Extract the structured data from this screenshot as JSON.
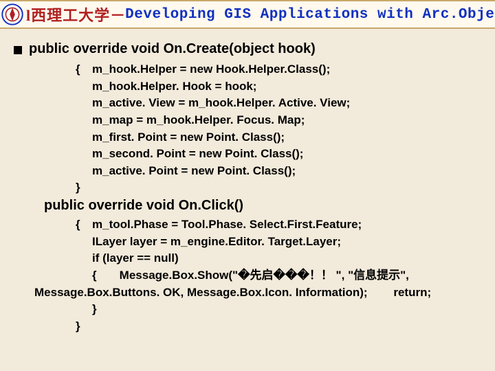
{
  "title": {
    "university": "l西理工大学",
    "separator": "－",
    "course": "Developing GIS Applications with Arc.Objects using C#. NE"
  },
  "section1": {
    "signature": "public override void On.Create(object hook)",
    "lines": [
      "m_hook.Helper = new Hook.Helper.Class();",
      "m_hook.Helper. Hook = hook;",
      "m_active. View = m_hook.Helper. Active. View;",
      "m_map = m_hook.Helper. Focus. Map;",
      "m_first. Point = new Point. Class();",
      "m_second. Point = new Point. Class();",
      "m_active. Point = new Point. Class();"
    ],
    "open": "{",
    "close": "}"
  },
  "section2": {
    "signature": "public override void On.Click()",
    "lines": [
      "m_tool.Phase = Tool.Phase. Select.First.Feature;",
      "ILayer layer = m_engine.Editor. Target.Layer;",
      "if (layer == null)"
    ],
    "msgbox_a": "{       Message.Box.Show(\"�先启���！！ \", \"信息提示\",",
    "msgbox_b": "Message.Box.Buttons. OK, Message.Box.Icon. Information);        return;",
    "inner_close": "}",
    "open": "{",
    "close": "}"
  }
}
